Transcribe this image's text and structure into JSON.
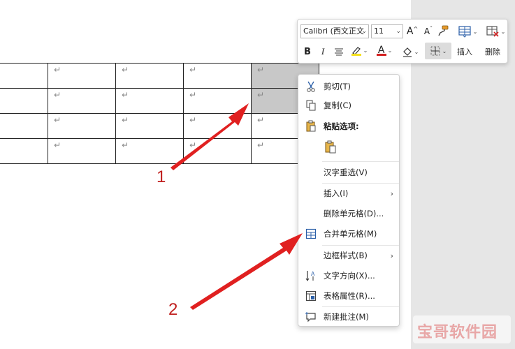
{
  "toolbar": {
    "font_name": "Calibri (西文正文",
    "font_size": "11",
    "bold": "B",
    "italic": "I",
    "grow_font": "A",
    "shrink_font": "A",
    "font_color_glyph": "A",
    "insert_label": "插入",
    "delete_label": "删除"
  },
  "table": {
    "cell_mark": "↵",
    "rows": 4,
    "cols": 5
  },
  "menu": {
    "items": [
      {
        "label": "剪切(T)",
        "icon": "scissors-icon"
      },
      {
        "label": "复制(C)",
        "icon": "copy-icon"
      },
      {
        "label": "粘贴选项:",
        "icon": "paste-icon"
      },
      {
        "label": "",
        "icon": "paste-keep-icon"
      },
      {
        "label": "汉字重选(V)",
        "icon": ""
      },
      {
        "label": "插入(I)",
        "icon": ""
      },
      {
        "label": "删除单元格(D)...",
        "icon": ""
      },
      {
        "label": "合并单元格(M)",
        "icon": "merge-cells-icon"
      },
      {
        "label": "边框样式(B)",
        "icon": ""
      },
      {
        "label": "文字方向(X)...",
        "icon": "text-direction-icon"
      },
      {
        "label": "表格属性(R)...",
        "icon": "table-properties-icon"
      },
      {
        "label": "新建批注(M)",
        "icon": "new-comment-icon"
      }
    ]
  },
  "annotations": {
    "label_1": "1",
    "label_2": "2"
  },
  "watermark": {
    "text": "宝哥软件园"
  },
  "colors": {
    "highlight_yellow": "#f5e11d",
    "font_red": "#d21f1f",
    "arrow_red": "#e02020",
    "selected_cell": "#c8c8c8"
  }
}
